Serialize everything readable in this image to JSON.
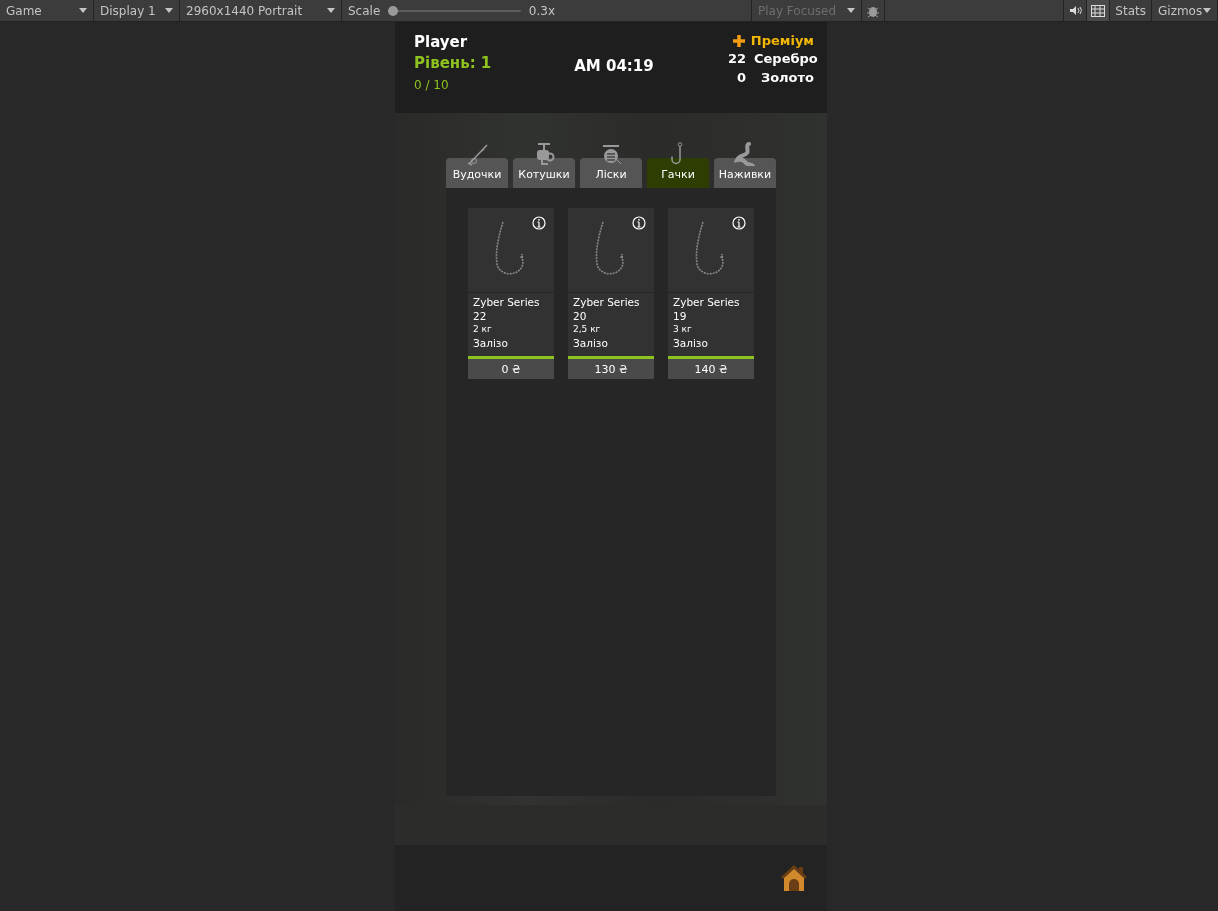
{
  "toolbar": {
    "view": {
      "label": "Game"
    },
    "display": {
      "label": "Display 1"
    },
    "resolution": {
      "label": "2960x1440 Portrait"
    },
    "scale": {
      "label": "Scale",
      "level": 0.0,
      "reading": "0.3x"
    },
    "play_mode": {
      "label": "Play Focused",
      "disabled": true
    },
    "mute": {
      "on": false
    },
    "stats": {
      "label": "Stats",
      "selected": false
    },
    "gizmos": {
      "label": "Gizmos"
    }
  },
  "header": {
    "player": "Player",
    "level": "Рівень: 1",
    "xp": "0 / 10",
    "time": "AM 04:19",
    "premium": "Преміум",
    "currencies": [
      {
        "amount": "22",
        "name": "Серебро"
      },
      {
        "amount": "0",
        "name": "Золото"
      }
    ]
  },
  "tabs": [
    {
      "kind": "rod",
      "label": "Вудочки",
      "selected": false
    },
    {
      "kind": "reel",
      "label": "Котушки",
      "selected": false
    },
    {
      "kind": "line",
      "label": "Ліски",
      "selected": false
    },
    {
      "kind": "hook",
      "label": "Гачки",
      "selected": true
    },
    {
      "kind": "bait",
      "label": "Наживки",
      "selected": false
    }
  ],
  "items": [
    {
      "name": "Zyber Series",
      "size": "22",
      "weight": "2 кг",
      "material": "Залізо",
      "price": "0 ₴"
    },
    {
      "name": "Zyber Series",
      "size": "20",
      "weight": "2,5 кг",
      "material": "Залізо",
      "price": "130 ₴"
    },
    {
      "name": "Zyber Series",
      "size": "19",
      "weight": "3 кг",
      "material": "Залізо",
      "price": "140 ₴"
    }
  ]
}
